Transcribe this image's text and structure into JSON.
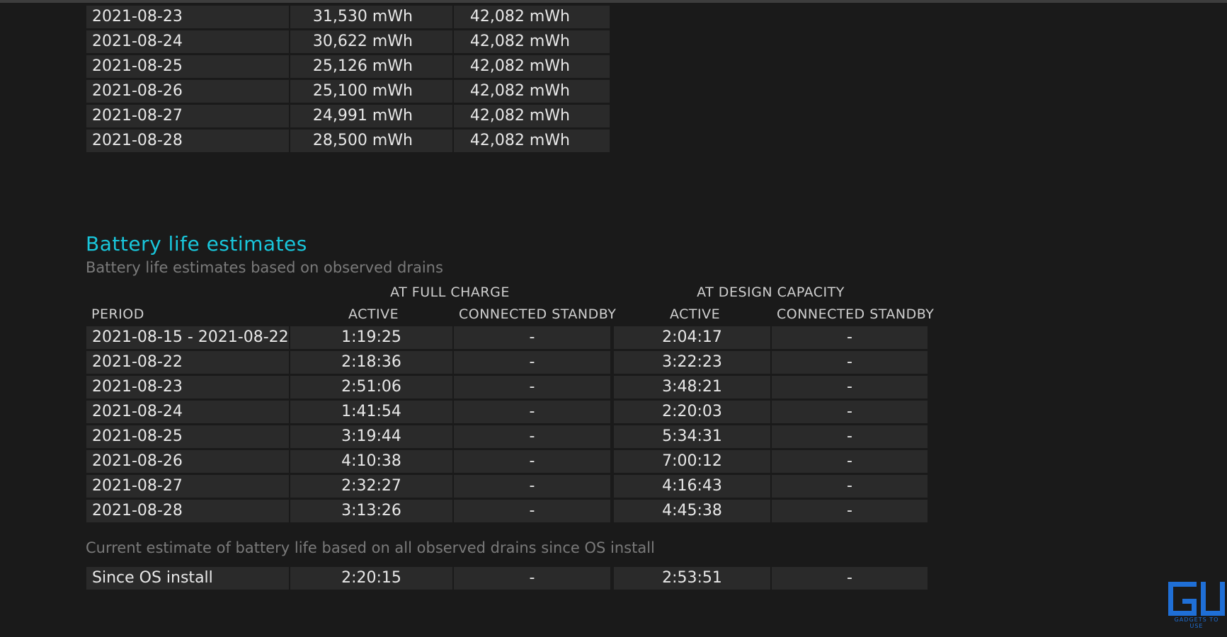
{
  "capacity_history": {
    "rows": [
      {
        "date": "2021-08-23",
        "full_charge": "31,530 mWh",
        "design": "42,082 mWh"
      },
      {
        "date": "2021-08-24",
        "full_charge": "30,622 mWh",
        "design": "42,082 mWh"
      },
      {
        "date": "2021-08-25",
        "full_charge": "25,126 mWh",
        "design": "42,082 mWh"
      },
      {
        "date": "2021-08-26",
        "full_charge": "25,100 mWh",
        "design": "42,082 mWh"
      },
      {
        "date": "2021-08-27",
        "full_charge": "24,991 mWh",
        "design": "42,082 mWh"
      },
      {
        "date": "2021-08-28",
        "full_charge": "28,500 mWh",
        "design": "42,082 mWh"
      }
    ]
  },
  "estimates": {
    "title": "Battery life estimates",
    "subtitle": "Battery life estimates based on observed drains",
    "group_full": "AT FULL CHARGE",
    "group_design": "AT DESIGN CAPACITY",
    "col_period": "PERIOD",
    "col_active": "ACTIVE",
    "col_standby": "CONNECTED STANDBY",
    "rows": [
      {
        "period": "2021-08-15 - 2021-08-22",
        "full_active": "1:19:25",
        "full_standby": "-",
        "design_active": "2:04:17",
        "design_standby": "-"
      },
      {
        "period": "2021-08-22",
        "full_active": "2:18:36",
        "full_standby": "-",
        "design_active": "3:22:23",
        "design_standby": "-"
      },
      {
        "period": "2021-08-23",
        "full_active": "2:51:06",
        "full_standby": "-",
        "design_active": "3:48:21",
        "design_standby": "-"
      },
      {
        "period": "2021-08-24",
        "full_active": "1:41:54",
        "full_standby": "-",
        "design_active": "2:20:03",
        "design_standby": "-"
      },
      {
        "period": "2021-08-25",
        "full_active": "3:19:44",
        "full_standby": "-",
        "design_active": "5:34:31",
        "design_standby": "-"
      },
      {
        "period": "2021-08-26",
        "full_active": "4:10:38",
        "full_standby": "-",
        "design_active": "7:00:12",
        "design_standby": "-"
      },
      {
        "period": "2021-08-27",
        "full_active": "2:32:27",
        "full_standby": "-",
        "design_active": "4:16:43",
        "design_standby": "-"
      },
      {
        "period": "2021-08-28",
        "full_active": "3:13:26",
        "full_standby": "-",
        "design_active": "4:45:38",
        "design_standby": "-"
      }
    ],
    "note": "Current estimate of battery life based on all observed drains since OS install",
    "since_install": {
      "period": "Since OS install",
      "full_active": "2:20:15",
      "full_standby": "-",
      "design_active": "2:53:51",
      "design_standby": "-"
    }
  },
  "watermark": {
    "name": "GADGETS TO USE",
    "icon": "gadgets-to-use-logo",
    "color": "#1f6fd6"
  },
  "colors": {
    "accent": "#19c6db",
    "background": "#1a1a1a",
    "row": "#2a2a2a"
  }
}
